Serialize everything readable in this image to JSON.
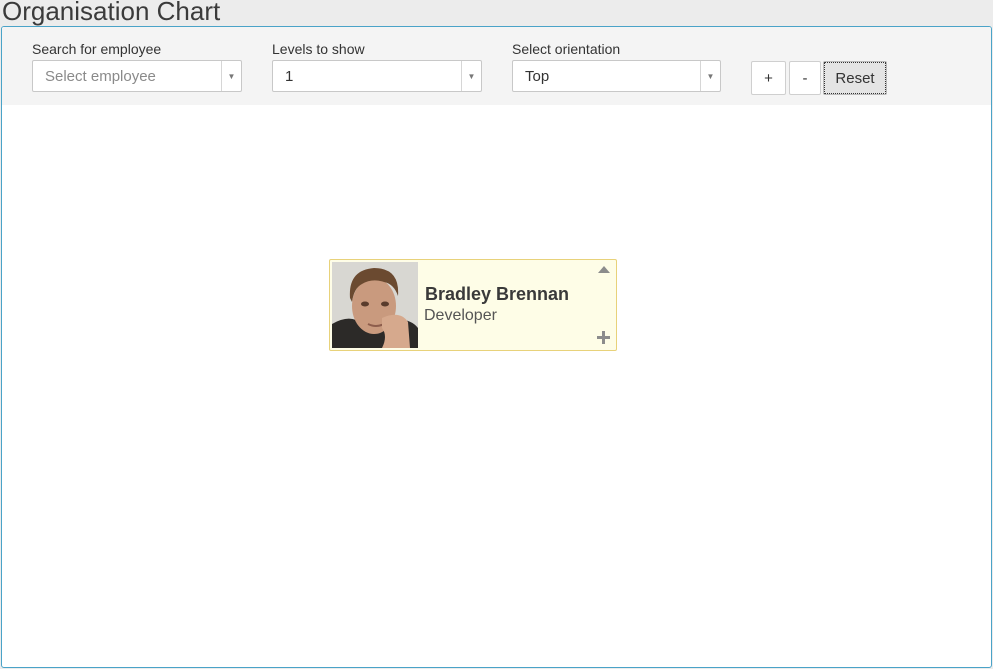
{
  "page": {
    "title": "Organisation Chart"
  },
  "toolbar": {
    "search": {
      "label": "Search for employee",
      "placeholder": "Select employee"
    },
    "levels": {
      "label": "Levels to show",
      "value": "1"
    },
    "orientation": {
      "label": "Select orientation",
      "value": "Top"
    },
    "zoom_in_label": "+",
    "zoom_out_label": "-",
    "reset_label": "Reset"
  },
  "employee": {
    "name": "Bradley Brennan",
    "role": "Developer"
  },
  "icons": {
    "dropdown_arrow": "▼",
    "collapse": "triangle-up-icon",
    "expand": "plus-icon"
  },
  "colors": {
    "panel_border": "#4aa3c8",
    "card_background": "#fefde7",
    "card_border": "#e8d27a",
    "icon_gray": "#8c8c8c"
  }
}
